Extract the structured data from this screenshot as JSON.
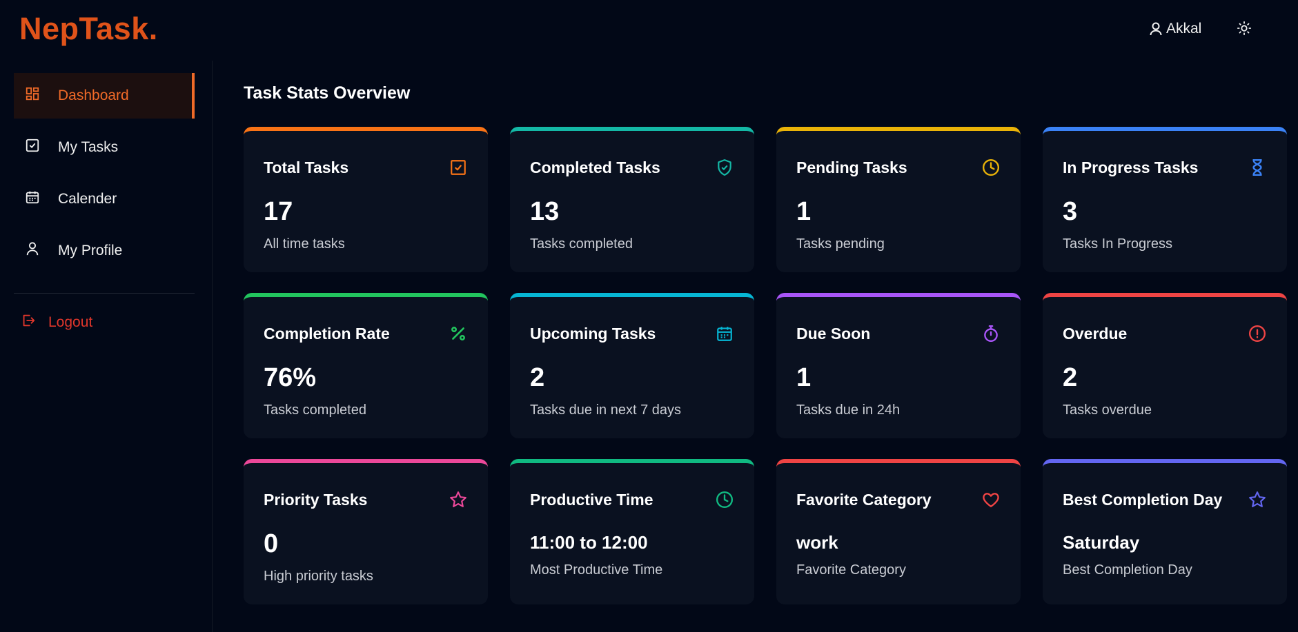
{
  "header": {
    "logo": "NepTask.",
    "user_name": "Akkal",
    "user_icon": "user-icon",
    "theme_icon": "sun-icon"
  },
  "sidebar": {
    "items": [
      {
        "label": "Dashboard",
        "icon": "dashboard-icon",
        "active": true
      },
      {
        "label": "My Tasks",
        "icon": "checkbox-icon",
        "active": false
      },
      {
        "label": "Calender",
        "icon": "calendar-icon",
        "active": false
      },
      {
        "label": "My Profile",
        "icon": "user-icon",
        "active": false
      }
    ],
    "logout_label": "Logout"
  },
  "main": {
    "title": "Task Stats Overview",
    "cards": [
      {
        "title": "Total Tasks",
        "value": "17",
        "subtitle": "All time tasks",
        "color": "#f97316",
        "icon": "checkbox-icon"
      },
      {
        "title": "Completed Tasks",
        "value": "13",
        "subtitle": "Tasks completed",
        "color": "#14b8a6",
        "icon": "shield-check-icon"
      },
      {
        "title": "Pending Tasks",
        "value": "1",
        "subtitle": "Tasks pending",
        "color": "#eab308",
        "icon": "clock-icon"
      },
      {
        "title": "In Progress Tasks",
        "value": "3",
        "subtitle": "Tasks In Progress",
        "color": "#3b82f6",
        "icon": "hourglass-icon"
      },
      {
        "title": "Completion Rate",
        "value": "76%",
        "subtitle": "Tasks completed",
        "color": "#22c55e",
        "icon": "percent-icon"
      },
      {
        "title": "Upcoming Tasks",
        "value": "2",
        "subtitle": "Tasks due in next 7 days",
        "color": "#06b6d4",
        "icon": "calendar-icon"
      },
      {
        "title": "Due Soon",
        "value": "1",
        "subtitle": "Tasks due in 24h",
        "color": "#a855f7",
        "icon": "stopwatch-icon"
      },
      {
        "title": "Overdue",
        "value": "2",
        "subtitle": "Tasks overdue",
        "color": "#ef4444",
        "icon": "alert-circle-icon"
      },
      {
        "title": "Priority Tasks",
        "value": "0",
        "subtitle": "High priority tasks",
        "color": "#ec4899",
        "icon": "star-icon"
      },
      {
        "title": "Productive Time",
        "value": "11:00 to 12:00",
        "subtitle": "Most Productive Time",
        "color": "#10b981",
        "icon": "clock-icon"
      },
      {
        "title": "Favorite Category",
        "value": "work",
        "subtitle": "Favorite Category",
        "color": "#ef4444",
        "icon": "heart-icon"
      },
      {
        "title": "Best Completion Day",
        "value": "Saturday",
        "subtitle": "Best Completion Day",
        "color": "#6366f1",
        "icon": "star-icon"
      }
    ]
  }
}
